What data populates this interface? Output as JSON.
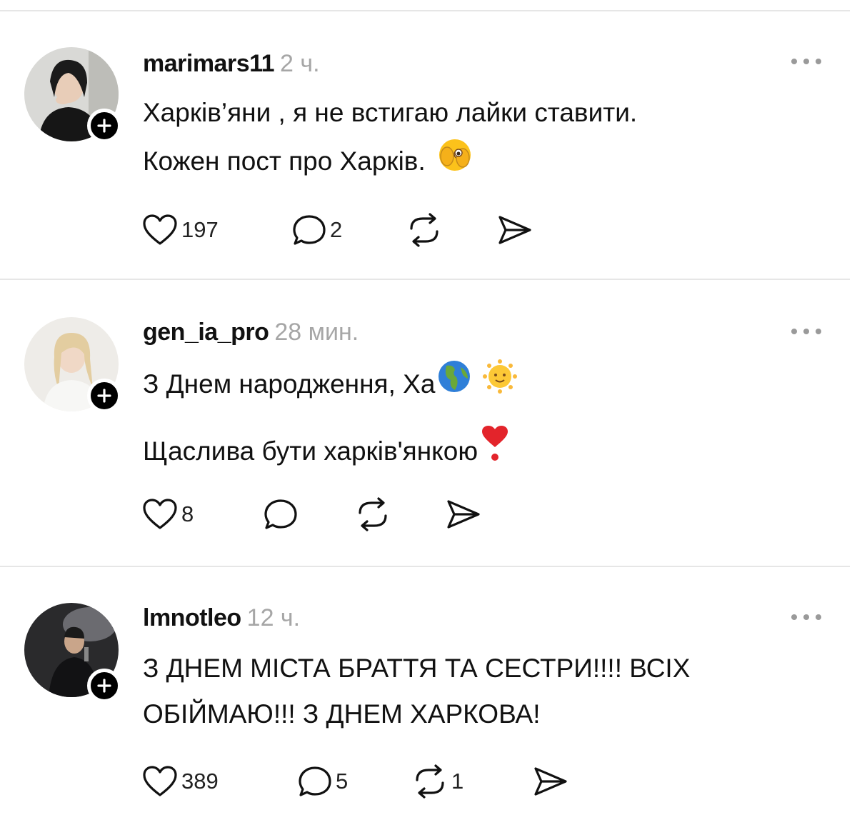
{
  "posts": [
    {
      "username": "marimars11",
      "time": "2 ч.",
      "lines": [
        "Харків’яни , я не встигаю лайки ставити.",
        "Кожен пост про Харків."
      ],
      "trailing_emoji": "face-with-eye-peeking-emoji",
      "likes": "197",
      "comments": "2",
      "reposts": ""
    },
    {
      "username": "gen_ia_pro",
      "time": "28 мин.",
      "lines": [
        "З Днем народження, Ха",
        "Щаслива бути харків'янкою"
      ],
      "inline_emoji": [
        "globe-emoji",
        "sun-face-emoji"
      ],
      "trailing_emoji": "heart-exclamation-emoji",
      "likes": "8",
      "comments": "",
      "reposts": ""
    },
    {
      "username": "lmnotleo",
      "time": "12 ч.",
      "lines": [
        "З ДНЕМ МІСТА БРАТТЯ ТА СЕСТРИ!!!! ВСІХ",
        "ОБІЙМАЮ!!! З ДНЕМ ХАРКОВА!"
      ],
      "likes": "389",
      "comments": "5",
      "reposts": "1"
    }
  ],
  "colors": {
    "text": "#111111",
    "muted": "#a6a6a6",
    "divider": "#e6e6e6",
    "badge": "#000000"
  }
}
